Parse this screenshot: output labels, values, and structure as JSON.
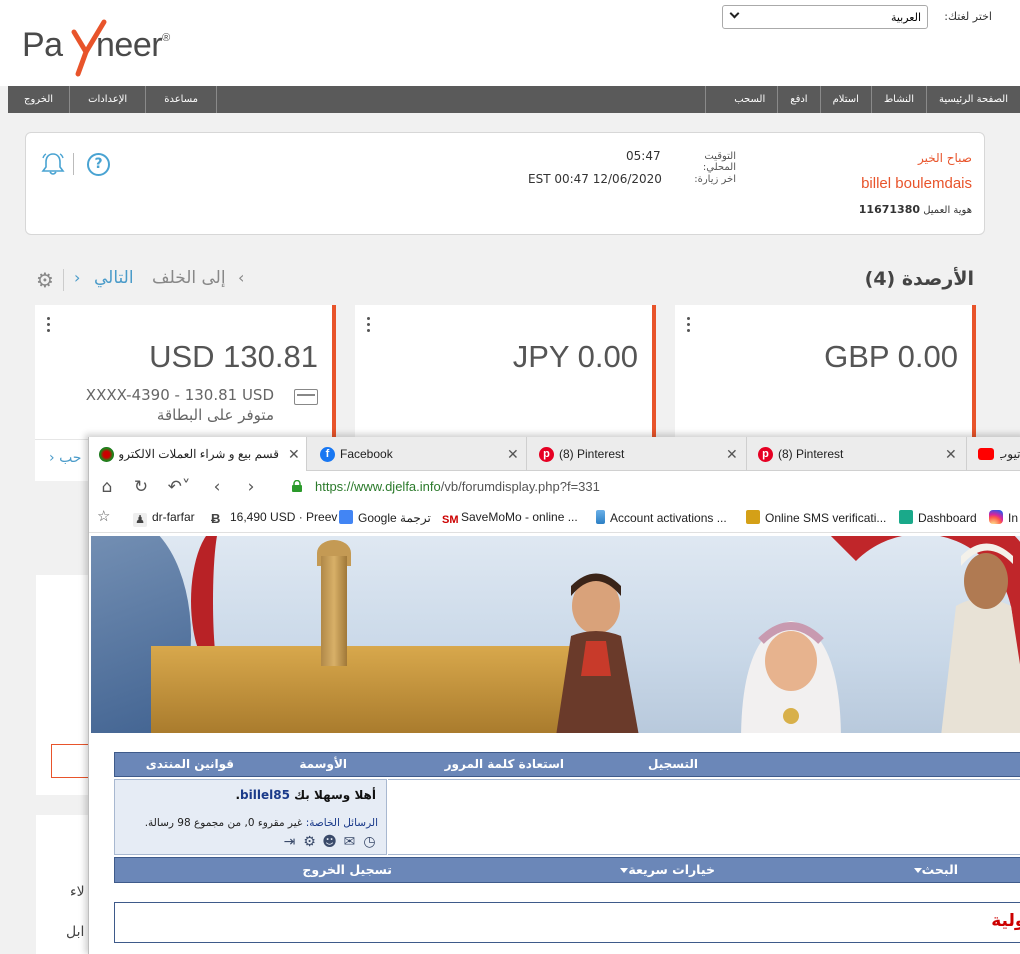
{
  "payoneer": {
    "logo": {
      "pay": "Pa",
      "neer": "neer",
      "reg": "®"
    },
    "language": {
      "label": "اختر لغتك:",
      "selected": "العربية"
    },
    "nav_right": [
      "الصفحة الرئيسية",
      "النشاط",
      "استلام",
      "ادفع",
      "السحب"
    ],
    "nav_left": [
      "مساعدة",
      "الإعدادات",
      "الخروج"
    ],
    "welcome": {
      "greeting": "صباح الخير",
      "name": "billel boulemdais",
      "customer_id_label": "هوية العميل",
      "customer_id": "11671380",
      "local_time_label": "التوقيت المحلي:",
      "local_time": "05:47",
      "last_visit_label": "اخر زيارة:",
      "last_visit": "EST 00:47 12/06/2020"
    },
    "balances": {
      "title": "الأرصدة (4)",
      "pager": {
        "back": "إلى الخلف",
        "next": "التالي",
        "chev_left": "‹",
        "chev_right": "›"
      },
      "cards": [
        {
          "amount": "GBP 0.00"
        },
        {
          "amount": "JPY 0.00"
        },
        {
          "amount": "USD 130.81",
          "card_info": "XXXX-4390 - 130.81 USD متوفر على البطاقة",
          "footer_link": "› حب"
        }
      ]
    },
    "bg_text": {
      "line1": "لاء",
      "line2": "ابل"
    }
  },
  "browser": {
    "tabs": [
      {
        "title": "قسم بيع و شراء العملات الالكترونية",
        "close": "✕",
        "active": true
      },
      {
        "title": "Facebook",
        "close": "✕"
      },
      {
        "title": "(8) Pinterest",
        "close": "✕"
      },
      {
        "title": "(8) Pinterest",
        "close": "✕"
      },
      {
        "title": "يوتيوب",
        "close": ""
      }
    ],
    "url": {
      "host": "https://www.djelfa.info",
      "path": "/vb/forumdisplay.php?f=331"
    },
    "bookmarks": [
      "dr-farfar",
      "16,490 USD · Preev",
      "Google ترجمة",
      "SaveMoMo - online ...",
      "Account activations ...",
      "Online SMS verificati...",
      "Dashboard",
      "In"
    ],
    "forum": {
      "nav": [
        "قوانين المنتدى",
        "الأوسمة",
        "استعادة كلمة المرور",
        "التسجيل"
      ],
      "welcome_prefix": "أهلا وسهلا بك ",
      "username": "billel85",
      "welcome_suffix": ".",
      "pm_label": "الرسائل الخاصة:",
      "pm_text": " غير مقروء 0, من مجموع 98 رسالة.",
      "bar": [
        "البحث",
        "خيارات سريعة",
        "تسجيل الخروج"
      ],
      "notice": "ؤولية"
    }
  }
}
